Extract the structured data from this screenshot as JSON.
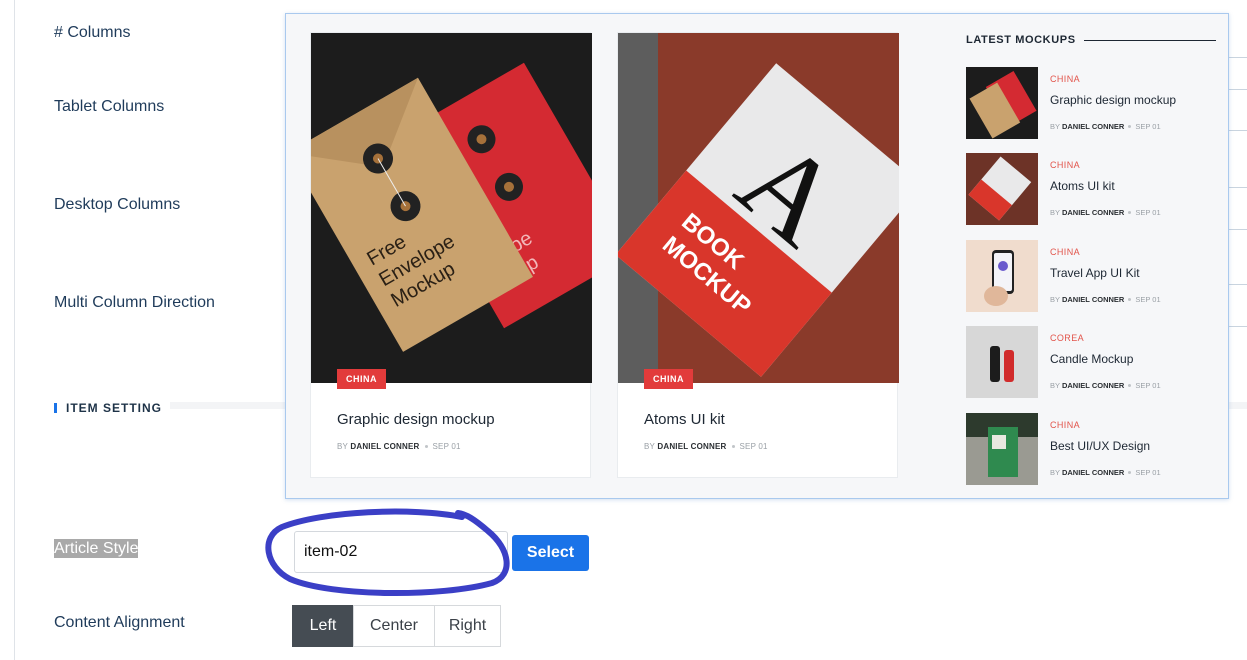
{
  "form": {
    "columns_label": "# Columns",
    "tablet_columns_label": "Tablet Columns",
    "desktop_columns_label": "Desktop Columns",
    "multi_column_direction_label": "Multi Column Direction",
    "section_title": "ITEM SETTING",
    "article_style_label": "Article Style",
    "article_style_value": "item-02",
    "select_button": "Select",
    "content_alignment_label": "Content Alignment",
    "alignment_options": [
      "Left",
      "Center",
      "Right"
    ],
    "alignment_selected": "Left"
  },
  "preview": {
    "cards": [
      {
        "tag": "CHINA",
        "title": "Graphic design mockup",
        "by": "BY",
        "author": "DANIEL CONNER",
        "date": "SEP 01"
      },
      {
        "tag": "CHINA",
        "title": "Atoms UI kit",
        "by": "BY",
        "author": "DANIEL CONNER",
        "date": "SEP 01"
      }
    ],
    "latest_title": "LATEST MOCKUPS",
    "latest": [
      {
        "cat": "CHINA",
        "title": "Graphic design mockup",
        "by": "BY",
        "author": "DANIEL CONNER",
        "date": "SEP 01"
      },
      {
        "cat": "CHINA",
        "title": "Atoms UI kit",
        "by": "BY",
        "author": "DANIEL CONNER",
        "date": "SEP 01"
      },
      {
        "cat": "CHINA",
        "title": "Travel App UI Kit",
        "by": "BY",
        "author": "DANIEL CONNER",
        "date": "SEP 01"
      },
      {
        "cat": "COREA",
        "title": "Candle Mockup",
        "by": "BY",
        "author": "DANIEL CONNER",
        "date": "SEP 01"
      },
      {
        "cat": "CHINA",
        "title": "Best UI/UX Design",
        "by": "BY",
        "author": "DANIEL CONNER",
        "date": "SEP 01"
      }
    ],
    "image_text": {
      "envelope": [
        "Free",
        "Envelope",
        "Mockup"
      ],
      "envelope_red": [
        "elope",
        "ckup"
      ],
      "book": [
        "BOOK",
        "MOCKUP"
      ],
      "book_letter": "A"
    }
  },
  "colors": {
    "accent": "#1a73e8",
    "tag_red": "#e23b3b",
    "annotation": "#3b3fc6",
    "active_button": "#454c53"
  }
}
